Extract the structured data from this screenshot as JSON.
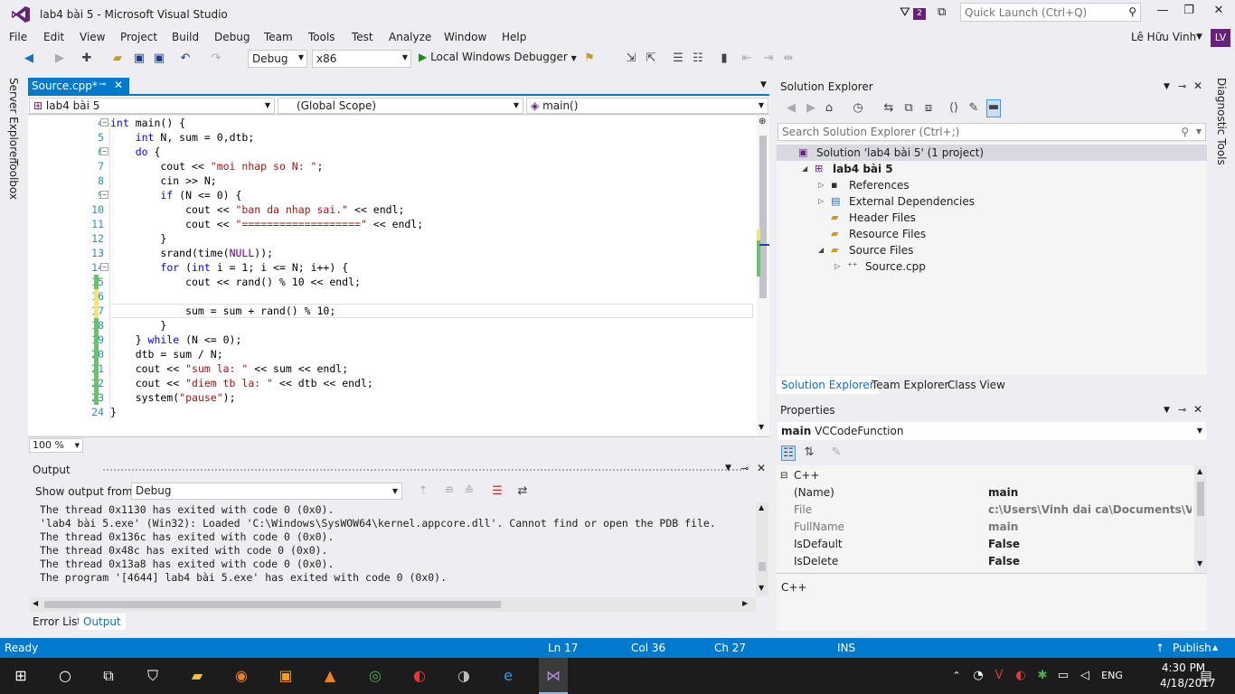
{
  "window": {
    "title": "lab4 bài 5 - Microsoft Visual Studio",
    "notification_count": "2",
    "quick_launch_placeholder": "Quick Launch (Ctrl+Q)",
    "minimize": "—",
    "maximize": "❐",
    "close": "✕"
  },
  "menu": [
    "File",
    "Edit",
    "View",
    "Project",
    "Build",
    "Debug",
    "Team",
    "Tools",
    "Test",
    "Analyze",
    "Window",
    "Help"
  ],
  "user": {
    "name": "Lê Hữu Vinh",
    "initials": "LV"
  },
  "toolbar": {
    "configuration": "Debug",
    "platform": "x86",
    "run_label": "Local Windows Debugger"
  },
  "side_tabs": {
    "left": [
      "Server Explorer",
      "Toolbox"
    ],
    "right": [
      "Diagnostic Tools"
    ]
  },
  "editor": {
    "tab_label": "Source.cpp*",
    "nav_project": "lab4 bài 5",
    "nav_scope": "(Global Scope)",
    "nav_member": "main()",
    "zoom": "100 %",
    "lines": [
      {
        "n": "4",
        "text": "int main() {"
      },
      {
        "n": "5",
        "text": "    int N, sum = 0,dtb;"
      },
      {
        "n": "6",
        "text": "    do {"
      },
      {
        "n": "7",
        "text": "        cout << \"moi nhap so N: \";"
      },
      {
        "n": "8",
        "text": "        cin >> N;"
      },
      {
        "n": "9",
        "text": "        if (N <= 0) {"
      },
      {
        "n": "10",
        "text": "            cout << \"ban da nhap sai.\" << endl;"
      },
      {
        "n": "11",
        "text": "            cout << \"===================\" << endl;"
      },
      {
        "n": "12",
        "text": "        }"
      },
      {
        "n": "13",
        "text": "        srand(time(NULL));"
      },
      {
        "n": "14",
        "text": "        for (int i = 1; i <= N; i++) {"
      },
      {
        "n": "15",
        "text": "            cout << rand() % 10 << endl;"
      },
      {
        "n": "16",
        "text": ""
      },
      {
        "n": "17",
        "text": "            sum = sum + rand() % 10;"
      },
      {
        "n": "18",
        "text": "        }"
      },
      {
        "n": "19",
        "text": "    } while (N <= 0);"
      },
      {
        "n": "20",
        "text": "    dtb = sum / N;"
      },
      {
        "n": "21",
        "text": "    cout << \"sum la: \" << sum << endl;"
      },
      {
        "n": "22",
        "text": "    cout << \"diem tb la: \" << dtb << endl;"
      },
      {
        "n": "23",
        "text": "    system(\"pause\");"
      },
      {
        "n": "24",
        "text": "}"
      }
    ]
  },
  "output": {
    "title": "Output",
    "show_from_label": "Show output from:",
    "source": "Debug",
    "lines": [
      "The thread 0x1130 has exited with code 0 (0x0).",
      "'lab4 bài 5.exe' (Win32): Loaded 'C:\\Windows\\SysWOW64\\kernel.appcore.dll'. Cannot find or open the PDB file.",
      "The thread 0x136c has exited with code 0 (0x0).",
      "The thread 0x48c has exited with code 0 (0x0).",
      "The thread 0x13a8 has exited with code 0 (0x0).",
      "The program '[4644] lab4 bài 5.exe' has exited with code 0 (0x0)."
    ],
    "tabs": [
      "Error List",
      "Output"
    ]
  },
  "solution_explorer": {
    "title": "Solution Explorer",
    "search_placeholder": "Search Solution Explorer (Ctrl+;)",
    "tree": [
      {
        "label": "Solution 'lab4 bài 5' (1 project)",
        "level": 0,
        "expander": ""
      },
      {
        "label": "lab4 bài 5",
        "level": 1,
        "expander": "◢"
      },
      {
        "label": "References",
        "level": 2,
        "expander": "▷"
      },
      {
        "label": "External Dependencies",
        "level": 2,
        "expander": "▷"
      },
      {
        "label": "Header Files",
        "level": 2,
        "expander": ""
      },
      {
        "label": "Resource Files",
        "level": 2,
        "expander": ""
      },
      {
        "label": "Source Files",
        "level": 2,
        "expander": "◢"
      },
      {
        "label": "Source.cpp",
        "level": 3,
        "expander": "▷"
      }
    ],
    "tabs": [
      "Solution Explorer",
      "Team Explorer",
      "Class View"
    ]
  },
  "properties": {
    "title": "Properties",
    "object_name": "main",
    "object_type": "VCCodeFunction",
    "category": "C++",
    "rows": [
      {
        "key": "(Name)",
        "value": "main"
      },
      {
        "key": "File",
        "value": "c:\\Users\\Vinh dai ca\\Documents\\Visual S"
      },
      {
        "key": "FullName",
        "value": "main"
      },
      {
        "key": "IsDefault",
        "value": "False"
      },
      {
        "key": "IsDelete",
        "value": "False"
      }
    ],
    "description": "C++"
  },
  "status": {
    "ready": "Ready",
    "ln": "Ln 17",
    "col": "Col 36",
    "ch": "Ch 27",
    "ins": "INS",
    "publish": "Publish"
  },
  "taskbar": {
    "lang": "ENG",
    "time": "4:30 PM",
    "date": "4/18/2017"
  }
}
